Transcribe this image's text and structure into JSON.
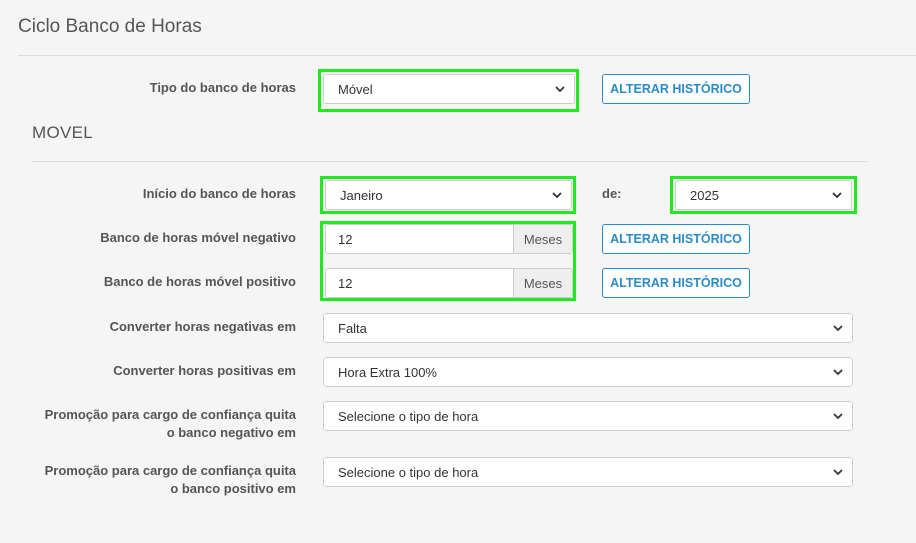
{
  "page_title": "Ciclo Banco de Horas",
  "section_title": "MOVEL",
  "tipo": {
    "label": "Tipo do banco de horas",
    "value": "Móvel",
    "button": "ALTERAR HISTÓRICO"
  },
  "inicio": {
    "label": "Início do banco de horas",
    "month": "Janeiro",
    "de_label": "de:",
    "year": "2025"
  },
  "negativo": {
    "label": "Banco de horas móvel negativo",
    "value": "12",
    "unit": "Meses",
    "button": "ALTERAR HISTÓRICO"
  },
  "positivo": {
    "label": "Banco de horas móvel positivo",
    "value": "12",
    "unit": "Meses",
    "button": "ALTERAR HISTÓRICO"
  },
  "converter_negativas": {
    "label": "Converter horas negativas em",
    "value": "Falta"
  },
  "converter_positivas": {
    "label": "Converter horas positivas em",
    "value": "Hora Extra 100%"
  },
  "promocao_negativo": {
    "label_line1": "Promoção para cargo de confiança quita",
    "label_line2": "o banco negativo em",
    "value": "Selecione o tipo de hora"
  },
  "promocao_positivo": {
    "label_line1": "Promoção para cargo de confiança quita",
    "label_line2": "o banco positivo em",
    "value": "Selecione o tipo de hora"
  },
  "colors": {
    "highlight": "#22e81e",
    "accent": "#2a8bc8"
  }
}
